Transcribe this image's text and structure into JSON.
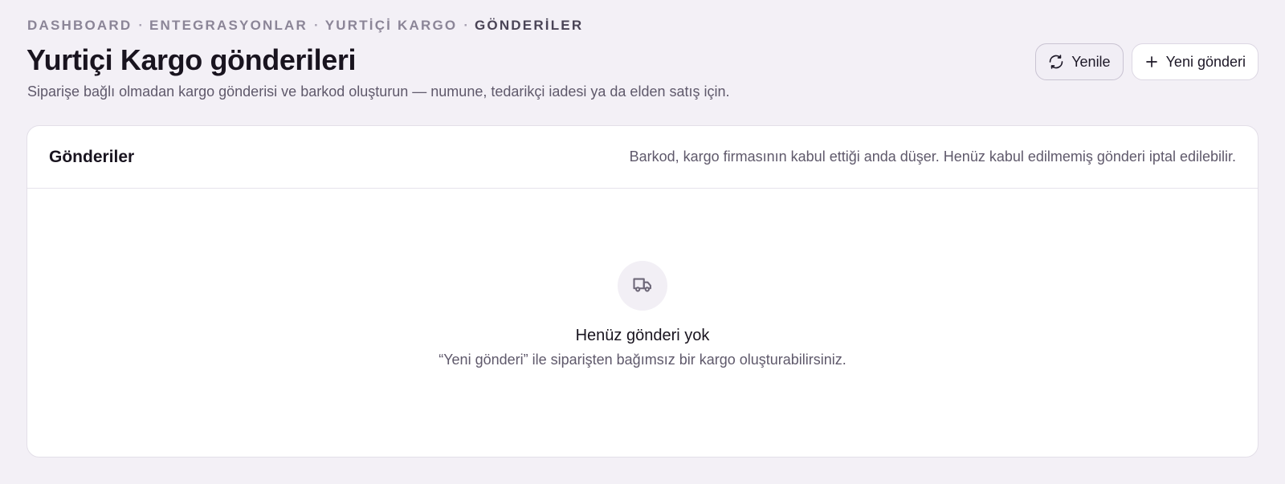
{
  "breadcrumb": {
    "items": [
      "DASHBOARD",
      "ENTEGRASYONLAR",
      "YURTİÇİ KARGO",
      "GÖNDERİLER"
    ],
    "separator": "·"
  },
  "header": {
    "title": "Yurtiçi Kargo gönderileri",
    "subtitle": "Siparişe bağlı olmadan kargo gönderisi ve barkod oluşturun — numune, tedarikçi iadesi ya da elden satış için."
  },
  "actions": {
    "refresh_label": "Yenile",
    "refresh_icon": "refresh-icon",
    "new_label": "Yeni gönderi",
    "new_icon": "plus-icon"
  },
  "shipments_card": {
    "title": "Gönderiler",
    "note": "Barkod, kargo firmasının kabul ettiği anda düşer. Henüz kabul edilmemiş gönderi iptal edilebilir.",
    "empty_state": {
      "icon": "truck-icon",
      "title": "Henüz gönderi yok",
      "description": "“Yeni gönderi” ile siparişten bağımsız bir kargo oluşturabilirsiniz."
    }
  },
  "colors": {
    "background": "#f3f0f6",
    "card": "#ffffff",
    "text_primary": "#19141f",
    "text_muted": "#5f596b",
    "breadcrumb_muted": "#8b8597",
    "breadcrumb_current": "#4a4456"
  }
}
